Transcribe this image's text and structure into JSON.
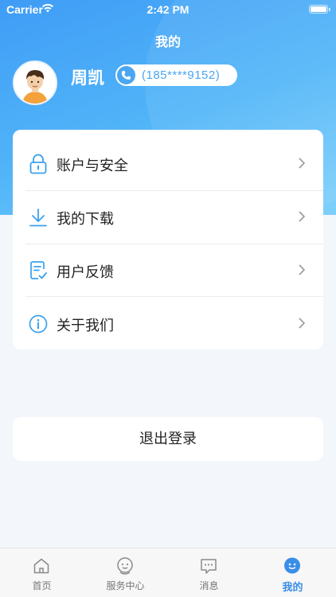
{
  "status_bar": {
    "carrier": "Carrier",
    "time": "2:42 PM"
  },
  "header": {
    "title": "我的",
    "user_name": "周凯",
    "phone": "(185****9152)"
  },
  "menu": [
    {
      "label": "账户与安全",
      "icon": "lock-icon"
    },
    {
      "label": "我的下载",
      "icon": "download-icon"
    },
    {
      "label": "用户反馈",
      "icon": "feedback-icon"
    },
    {
      "label": "关于我们",
      "icon": "info-icon"
    }
  ],
  "logout_label": "退出登录",
  "tabs": [
    {
      "label": "首页",
      "icon": "home-icon"
    },
    {
      "label": "服务中心",
      "icon": "service-icon"
    },
    {
      "label": "消息",
      "icon": "message-icon"
    },
    {
      "label": "我的",
      "icon": "profile-icon",
      "active": true
    }
  ],
  "colors": {
    "accent": "#3a8ee6",
    "icon_blue": "#4aa6f2",
    "header_start": "#3f9cf6",
    "header_end": "#7fd0fb"
  }
}
